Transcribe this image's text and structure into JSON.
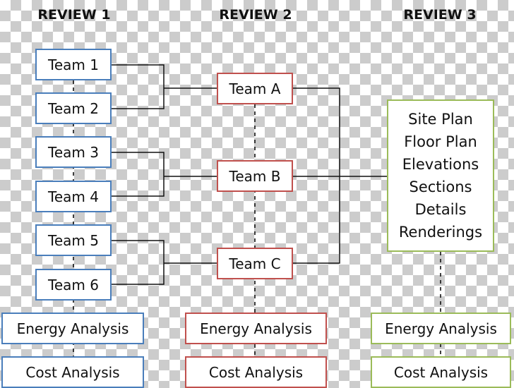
{
  "headers": [
    "REVIEW 1",
    "REVIEW 2",
    "REVIEW 3"
  ],
  "review1": {
    "teams": [
      "Team 1",
      "Team 2",
      "Team 3",
      "Team 4",
      "Team 5",
      "Team 6"
    ],
    "energy": "Energy Analysis",
    "cost": "Cost Analysis"
  },
  "review2": {
    "teams": [
      "Team A",
      "Team B",
      "Team C"
    ],
    "energy": "Energy Analysis",
    "cost": "Cost Analysis"
  },
  "review3": {
    "deliverables": [
      "Site Plan",
      "Floor Plan",
      "Elevations",
      "Sections",
      "Details",
      "Renderings"
    ],
    "energy": "Energy Analysis",
    "cost": "Cost Analysis"
  },
  "colors": {
    "review1": "#4a7ebb",
    "review2": "#c0504d",
    "review3": "#9bbb59"
  }
}
